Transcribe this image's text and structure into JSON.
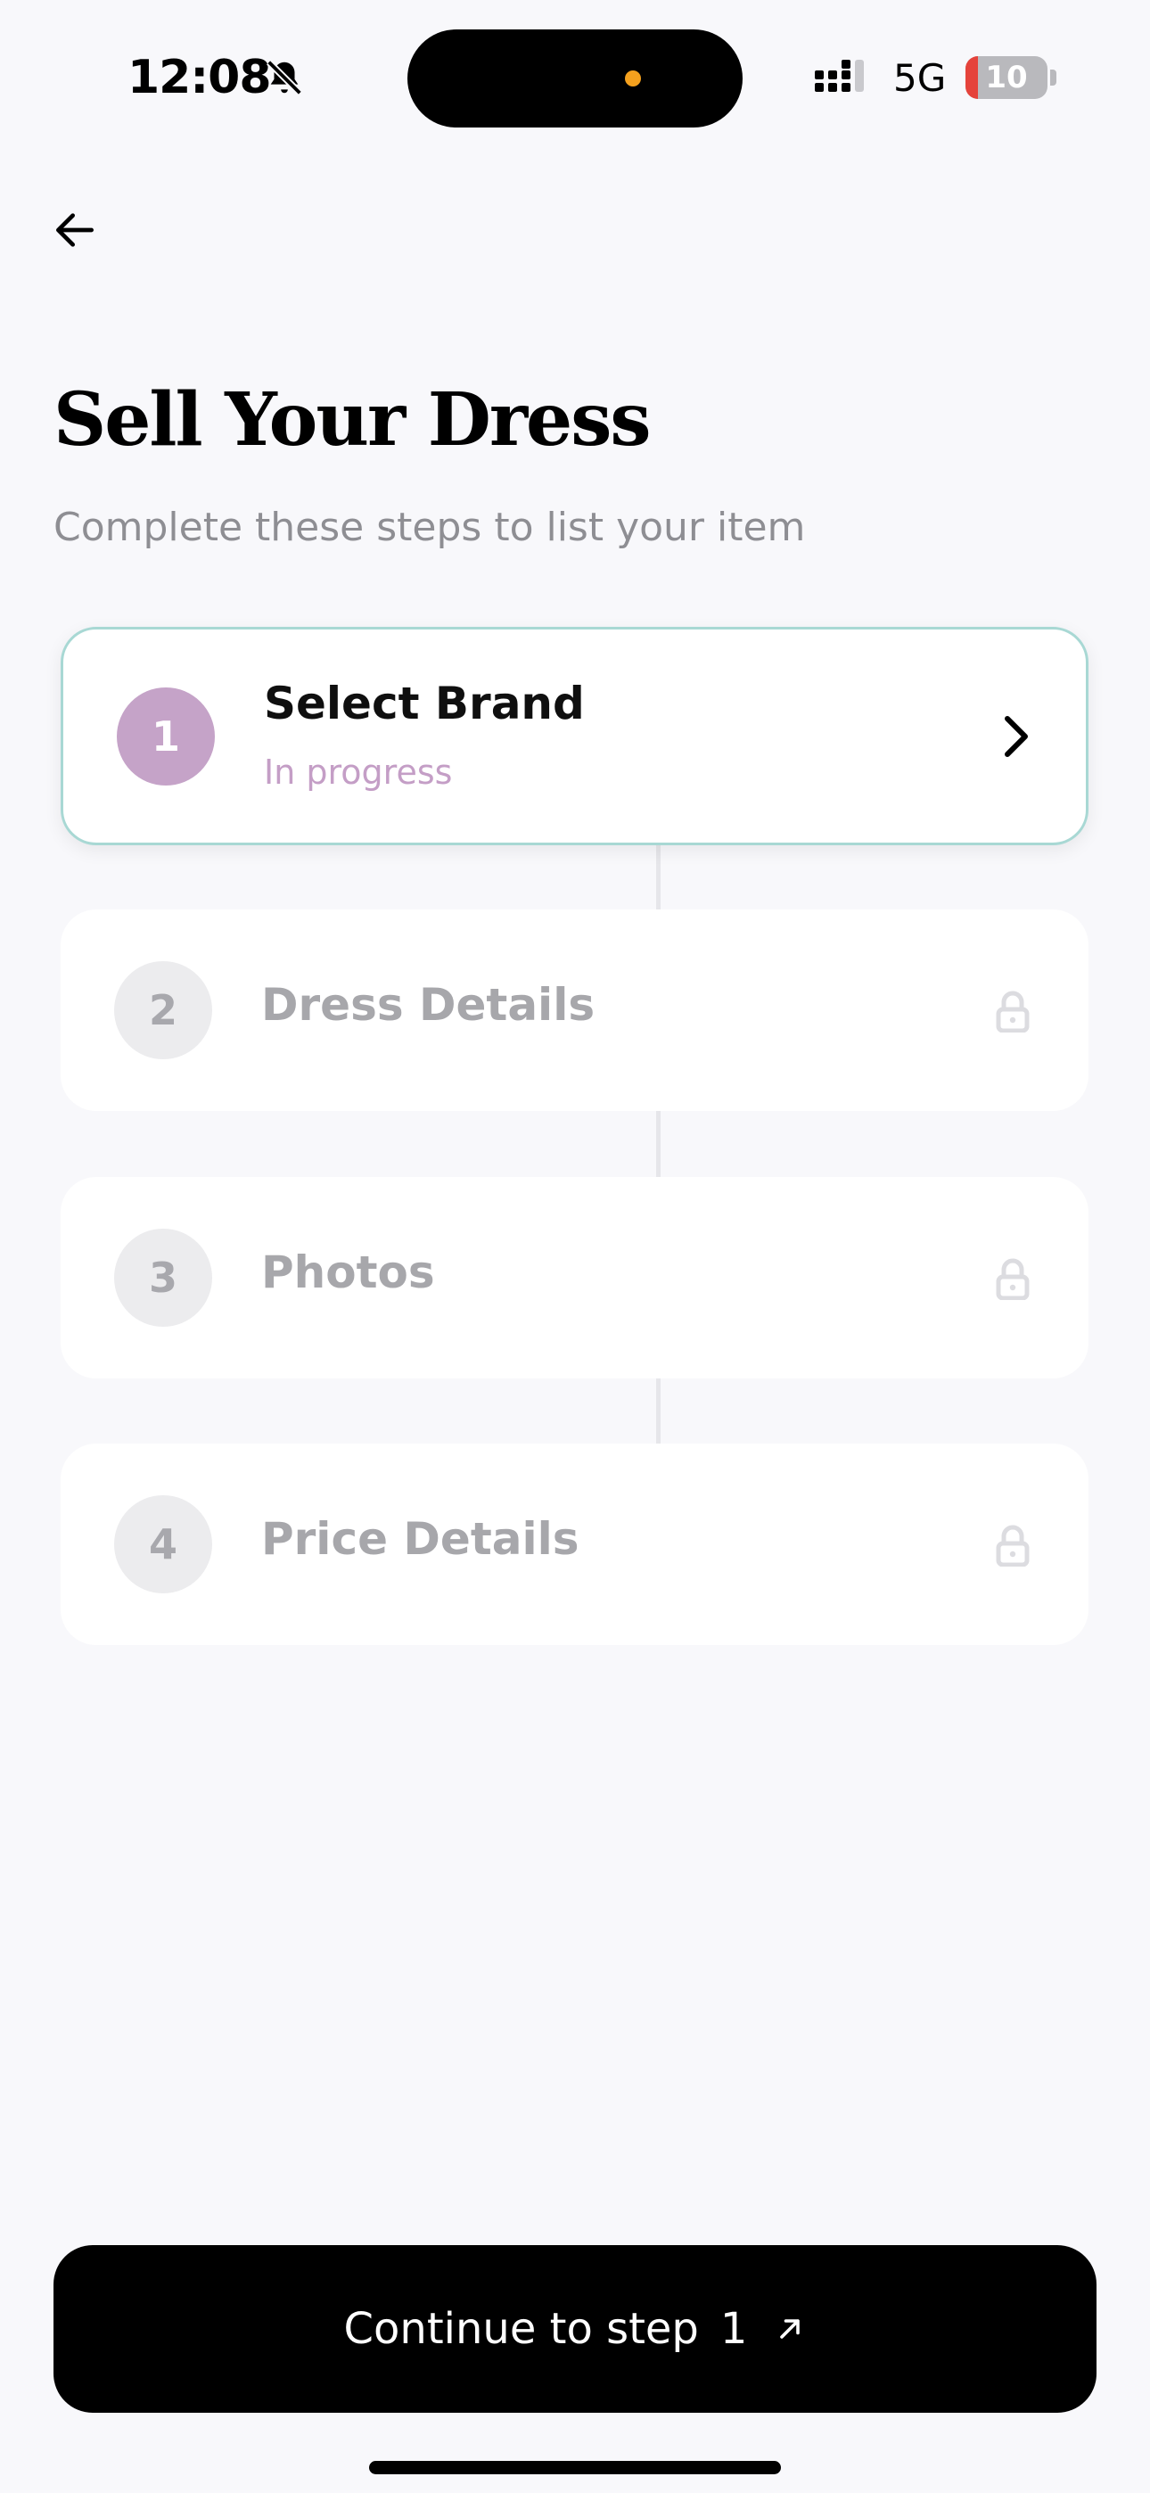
{
  "status_bar": {
    "time": "12:08",
    "network": "5G",
    "battery": "10",
    "battery_color": "#e5433b",
    "icons": [
      "bell-slash-icon",
      "signal-bars-icon",
      "battery-icon"
    ]
  },
  "header": {
    "back_icon": "arrow-left-icon",
    "title": "Sell Your Dress",
    "subtitle": "Complete these steps to list your item"
  },
  "steps": [
    {
      "number": "1",
      "title": "Select Brand",
      "status": "In progress",
      "state": "active",
      "icon": "chevron-right-icon"
    },
    {
      "number": "2",
      "title": "Dress Details",
      "state": "locked",
      "icon": "lock-icon"
    },
    {
      "number": "3",
      "title": "Photos",
      "state": "locked",
      "icon": "lock-icon"
    },
    {
      "number": "4",
      "title": "Price Details",
      "state": "locked",
      "icon": "lock-icon"
    }
  ],
  "cta": {
    "label": "Continue to step",
    "step": "1",
    "icon": "arrow-up-right-icon"
  },
  "colors": {
    "accent_purple": "#c5a3c8",
    "active_border": "#a8d8d4",
    "background": "#f8f8fb"
  }
}
